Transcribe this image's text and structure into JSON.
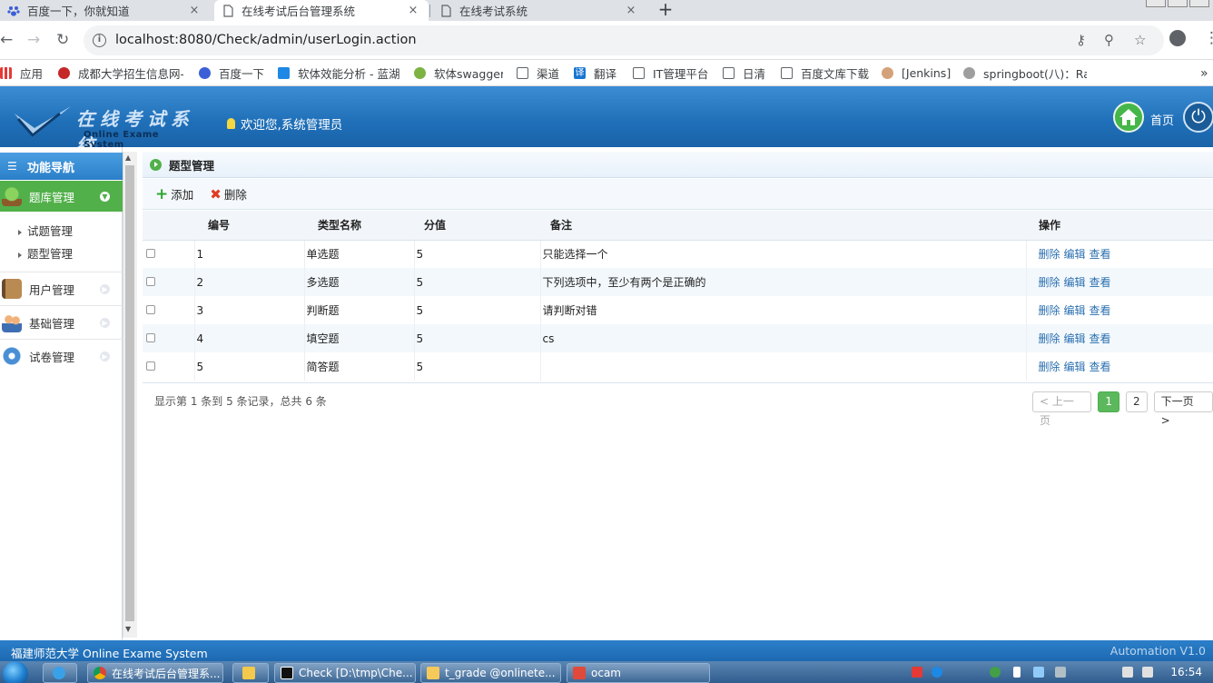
{
  "browser": {
    "tabs": [
      {
        "title": "百度一下，你就知道",
        "icon": "baidu-paw-icon",
        "active": false
      },
      {
        "title": "在线考试后台管理系统",
        "icon": "page-icon",
        "active": true
      },
      {
        "title": "在线考试系统",
        "icon": "page-icon",
        "active": false
      }
    ],
    "close_glyph": "×",
    "new_tab_glyph": "+",
    "url": "localhost:8080/Check/admin/userLogin.action",
    "bookmarks": [
      {
        "label": "应用",
        "icon": "apps-grid-icon"
      },
      {
        "label": "成都大学招生信息网-",
        "icon": "university-icon"
      },
      {
        "label": "百度一下",
        "icon": "baidu-paw-icon"
      },
      {
        "label": "软体效能分析 - 蓝湖",
        "icon": "lanhu-icon"
      },
      {
        "label": "软体swagger",
        "icon": "swagger-icon"
      },
      {
        "label": "渠道",
        "icon": "page-icon"
      },
      {
        "label": "翻译",
        "icon": "translate-icon"
      },
      {
        "label": "IT管理平台",
        "icon": "page-icon"
      },
      {
        "label": "日清",
        "icon": "page-icon"
      },
      {
        "label": "百度文库下载",
        "icon": "page-icon"
      },
      {
        "label": "[Jenkins]",
        "icon": "jenkins-icon"
      },
      {
        "label": "springboot(八)：Ra",
        "icon": "springboot-icon"
      }
    ],
    "more_glyph": "»"
  },
  "header": {
    "logo_cn": "在线考试系统",
    "logo_en": "Online Exame System",
    "welcome": "欢迎您,系统管理员",
    "home_label": "首页"
  },
  "sidebar": {
    "nav_title": "功能导航",
    "menus": [
      {
        "label": "题库管理",
        "icon": "tree-icon",
        "expanded": true,
        "children": [
          "试题管理",
          "题型管理"
        ]
      },
      {
        "label": "用户管理",
        "icon": "book-icon",
        "expanded": false
      },
      {
        "label": "基础管理",
        "icon": "users-icon",
        "expanded": false
      },
      {
        "label": "试卷管理",
        "icon": "gear-icon",
        "expanded": false
      }
    ]
  },
  "main": {
    "panel_title": "题型管理",
    "toolbar": {
      "add": "添加",
      "delete": "删除"
    },
    "columns": [
      "编号",
      "类型名称",
      "分值",
      "备注",
      "操作"
    ],
    "rows": [
      {
        "id": "1",
        "name": "单选题",
        "score": "5",
        "remark": "只能选择一个"
      },
      {
        "id": "2",
        "name": "多选题",
        "score": "5",
        "remark": "下列选项中，至少有两个是正确的"
      },
      {
        "id": "3",
        "name": "判断题",
        "score": "5",
        "remark": "请判断对错"
      },
      {
        "id": "4",
        "name": "填空题",
        "score": "5",
        "remark": "cs"
      },
      {
        "id": "5",
        "name": "简答题",
        "score": "5",
        "remark": ""
      }
    ],
    "row_actions": [
      "删除",
      "编辑",
      "查看"
    ],
    "page_info": "显示第 1 条到 5 条记录，总共 6 条",
    "pager": {
      "prev": "< 上一页",
      "pages": [
        "1",
        "2"
      ],
      "current": "1",
      "next": "下一页 >"
    }
  },
  "footer": {
    "left": "福建师范大学  Online Exame System",
    "right": "Automation V1.0"
  },
  "taskbar": {
    "items": [
      {
        "label": "在线考试后台管理系...",
        "icon": "chrome-icon"
      },
      {
        "label": "Check [D:\\tmp\\Che...",
        "icon": "intellij-icon"
      },
      {
        "label": "t_grade @onlinete...",
        "icon": "navicat-icon"
      },
      {
        "label": "ocam",
        "icon": "ocam-icon"
      }
    ],
    "clock": "16:54"
  },
  "colors": {
    "header_blue": "#2277c2",
    "green": "#52b04a",
    "link": "#2a6fb0"
  }
}
